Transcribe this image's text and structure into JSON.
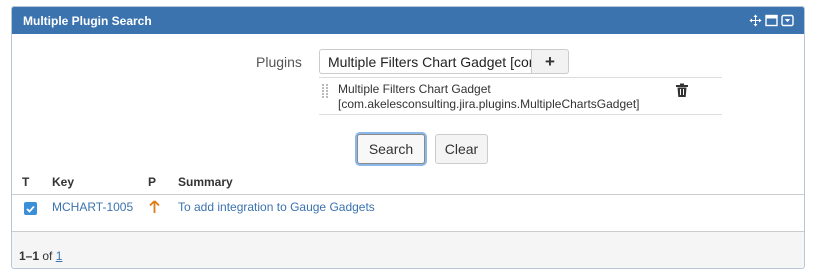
{
  "gadget": {
    "title": "Multiple Plugin Search",
    "icons": [
      "move-icon",
      "maximize-icon",
      "menu-dropdown-icon"
    ],
    "header_color": "#3b73af"
  },
  "form": {
    "plugins_label": "Plugins",
    "plugin_input_value": "Multiple Filters Chart Gadget [com.akelesconsulting.jira.plugins.MultipleChartsGadget]",
    "add_button_icon": "+",
    "selected_plugin": {
      "line1": "Multiple Filters Chart Gadget",
      "line2": "[com.akelesconsulting.jira.plugins.MultipleChartsGadget]"
    },
    "search_label": "Search",
    "clear_label": "Clear"
  },
  "table": {
    "columns": [
      "T",
      "Key",
      "P",
      "Summary"
    ],
    "rows": [
      {
        "type_checked": true,
        "key": "MCHART-1005",
        "priority_icon": "arrow-up-icon",
        "priority_color": "#e07a14",
        "summary": "To add integration to Gauge Gadgets"
      }
    ]
  },
  "pagination": {
    "range": "1–1",
    "of_label": "of",
    "total": "1"
  },
  "colors": {
    "link": "#3b73af",
    "checkbox": "#3b8ed8"
  }
}
